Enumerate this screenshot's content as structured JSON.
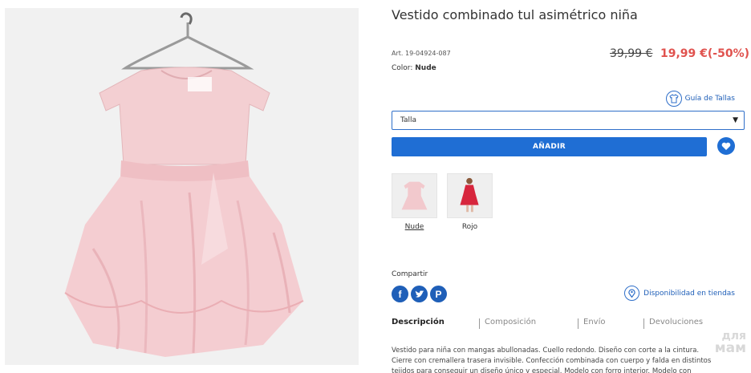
{
  "product": {
    "title": "Vestido combinado tul asimétrico niña",
    "art": "Art. 19-04924-087",
    "color_label": "Color:",
    "color_value": "Nude",
    "price_old": "39,99 €",
    "price_new": "19,99 €(-50%)"
  },
  "size_guide": {
    "label": "Guía de Tallas",
    "icon": "tshirt-icon"
  },
  "talla_select": {
    "value": "Talla"
  },
  "add_button": {
    "label": "AÑADIR"
  },
  "favorite": {
    "icon": "heart-icon"
  },
  "variants": [
    {
      "label": "Nude",
      "selected": true
    },
    {
      "label": "Rojo",
      "selected": false
    }
  ],
  "share": {
    "label": "Compartir",
    "icons": [
      "facebook-icon",
      "twitter-icon",
      "pinterest-icon"
    ]
  },
  "availability": {
    "label": "Disponibilidad en tiendas",
    "icon": "location-pin-icon"
  },
  "tabs": [
    {
      "label": "Descripción",
      "active": true
    },
    {
      "label": "Composición",
      "active": false
    },
    {
      "label": "Envío",
      "active": false
    },
    {
      "label": "Devoluciones",
      "active": false
    }
  ],
  "description": {
    "line1": "Vestido para niña con mangas abullonadas. Cuello redondo. Diseño con corte a la cintura.",
    "line2": "Cierre con cremallera trasera invisible. Confección combinada con cuerpo y falda en distintos",
    "line3": "tejidos para conseguir un diseño único y especial. Modelo con forro interior. Modelo con"
  },
  "watermark": {
    "line1": "для",
    "line2": "мам"
  },
  "colors": {
    "accent": "#1f6ed4",
    "link": "#1f5fb8",
    "price_sale": "#e0524e",
    "dress_nude": "#f2c9cd",
    "dress_red": "#d7263d"
  }
}
